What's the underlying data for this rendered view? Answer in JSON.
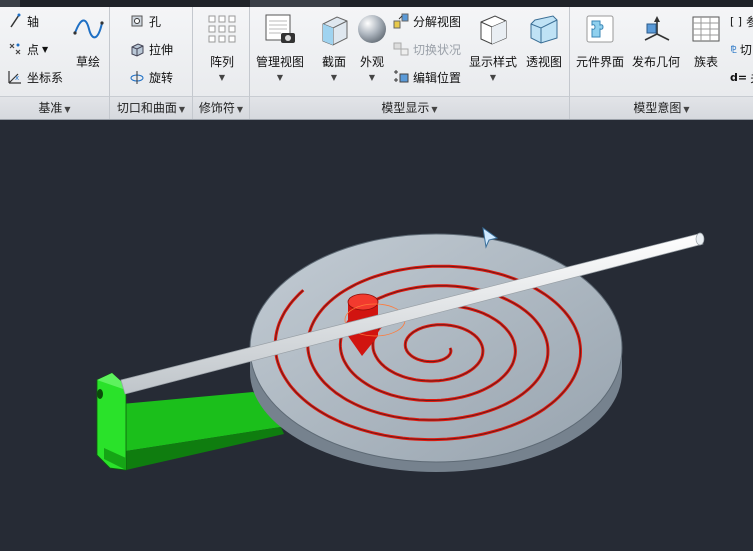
{
  "ribbon": {
    "groups": [
      {
        "label": "基准"
      },
      {
        "label": "切口和曲面"
      },
      {
        "label": "修饰符"
      },
      {
        "label": "模型显示"
      },
      {
        "label": "模型意图"
      }
    ],
    "datum": {
      "axis": "轴",
      "point": "点",
      "csys": "坐标系",
      "sketch": "草绘"
    },
    "cut": {
      "hole": "孔",
      "extrude": "拉伸",
      "revolve": "旋转"
    },
    "modifiers": {
      "pattern": "阵列"
    },
    "display": {
      "manager_views": "管理视图",
      "section": "截面",
      "appearance": "外观",
      "exploded_view": "分解视图",
      "toggle_status": "切换状况",
      "edit_position": "编辑位置",
      "display_style": "显示样式",
      "perspective": "透视图"
    },
    "intent": {
      "component_interface": "元件界面",
      "publish_geometry": "发布几何",
      "family_table": "族表",
      "frag1": "参",
      "frag2": "切",
      "frag3": "关"
    }
  },
  "colors": {
    "accent": "#1e6fc4",
    "canvas_bg": "#262b35",
    "bracket": "#22dd22",
    "spiral": "#dd1a10",
    "disk": "#a9b3bd",
    "rod": "#e8ecef"
  }
}
